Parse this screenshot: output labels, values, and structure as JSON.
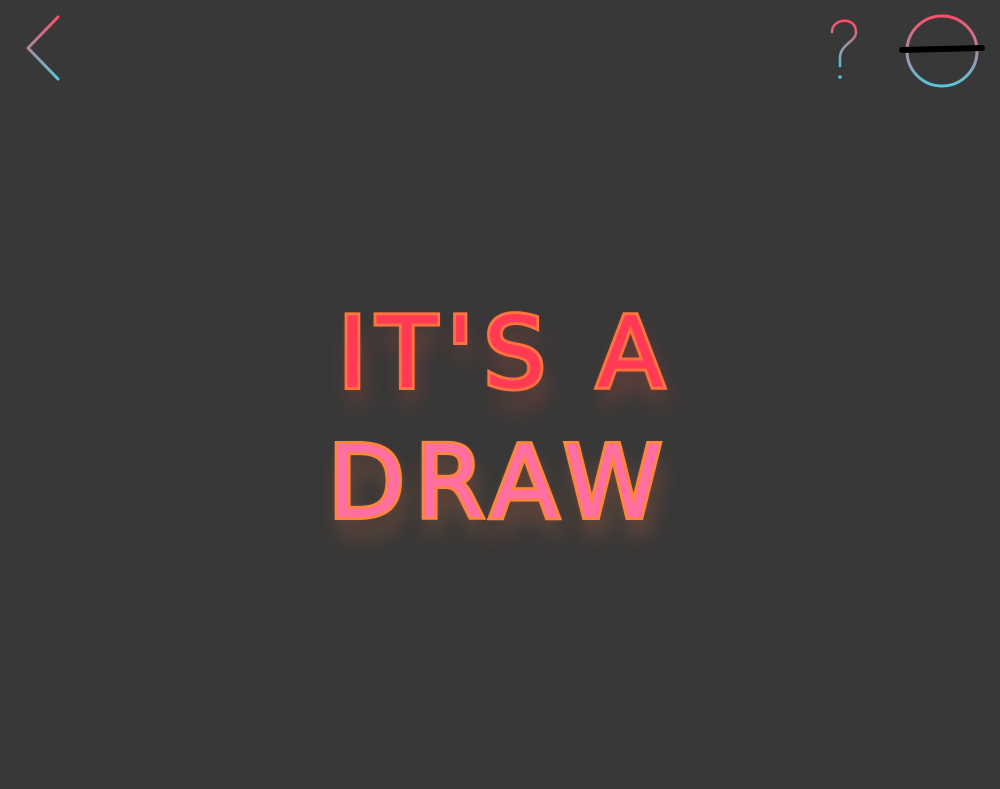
{
  "result": {
    "line1": "IT'S A",
    "line2": "DRAW"
  },
  "controls": {
    "back_icon": "chevron-left-icon",
    "help_icon": "question-mark-icon",
    "mode_icon": "circle-minus-icon"
  },
  "colors": {
    "background": "#383838",
    "accent_red": "#ff3a55",
    "accent_pink": "#ff6fa0",
    "accent_orange": "#ff8a3d",
    "accent_teal": "#58c6d8"
  }
}
